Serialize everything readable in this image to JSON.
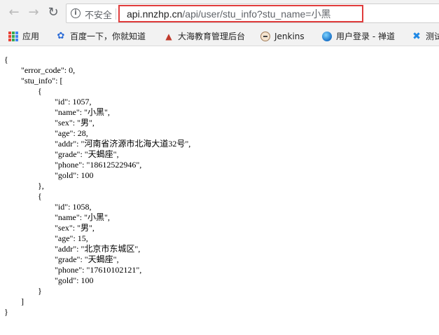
{
  "toolbar": {
    "back_icon": "arrow-left-icon",
    "forward_icon": "arrow-right-icon",
    "reload_icon": "reload-icon",
    "security_label": "不安全",
    "url_host": "api.nnzhp.cn",
    "url_path": "/api/user/stu_info?stu_name=小黑"
  },
  "bookmarks": [
    {
      "label": "应用",
      "icon": "apps-icon"
    },
    {
      "label": "百度一下，你就知道",
      "icon": "paw-icon"
    },
    {
      "label": "大海教育管理后台",
      "icon": "tree-icon"
    },
    {
      "label": "Jenkins",
      "icon": "jenkins-icon"
    },
    {
      "label": "用户登录 - 禅道",
      "icon": "globe-icon"
    },
    {
      "label": "测试",
      "icon": "x-icon"
    }
  ],
  "json_body": "{\n\t\"error_code\": 0,\n\t\"stu_info\": [\n\t\t{\n\t\t\t\"id\": 1057,\n\t\t\t\"name\": \"小黑\",\n\t\t\t\"sex\": \"男\",\n\t\t\t\"age\": 28,\n\t\t\t\"addr\": \"河南省济源市北海大道32号\",\n\t\t\t\"grade\": \"天蝎座\",\n\t\t\t\"phone\": \"18612522946\",\n\t\t\t\"gold\": 100\n\t\t},\n\t\t{\n\t\t\t\"id\": 1058,\n\t\t\t\"name\": \"小黑\",\n\t\t\t\"sex\": \"男\",\n\t\t\t\"age\": 15,\n\t\t\t\"addr\": \"北京市东城区\",\n\t\t\t\"grade\": \"天蝎座\",\n\t\t\t\"phone\": \"17610102121\",\n\t\t\t\"gold\": 100\n\t\t}\n\t]\n}"
}
